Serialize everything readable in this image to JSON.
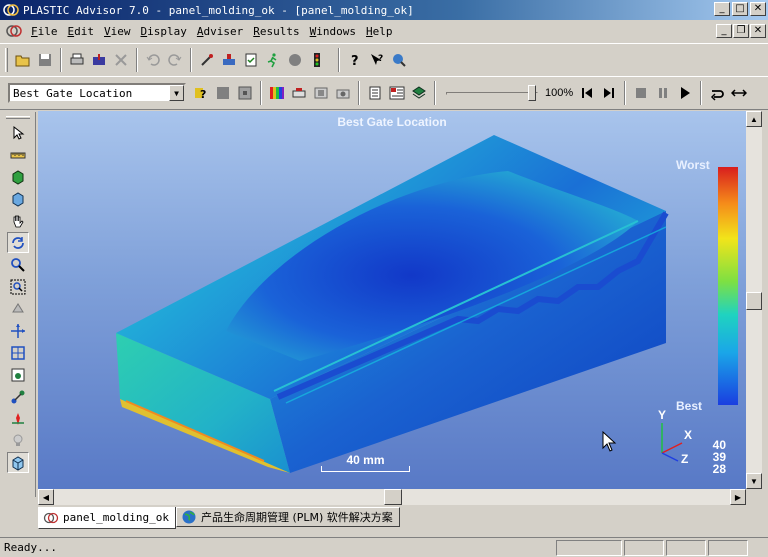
{
  "window": {
    "title": "PLASTIC Advisor 7.0 - panel_molding_ok - [panel_molding_ok]",
    "minimize_glyph": "_",
    "maximize_glyph": "□",
    "close_glyph": "✕",
    "restore_glyph": "❐"
  },
  "menubar": {
    "items": [
      {
        "key": "F",
        "rest": "ile"
      },
      {
        "key": "E",
        "rest": "dit"
      },
      {
        "key": "V",
        "rest": "iew"
      },
      {
        "key": "D",
        "rest": "isplay"
      },
      {
        "key": "A",
        "rest": "dviser"
      },
      {
        "key": "R",
        "rest": "esults"
      },
      {
        "key": "W",
        "rest": "indows"
      },
      {
        "key": "H",
        "rest": "elp"
      }
    ]
  },
  "toolbar2": {
    "result_select": "Best Gate Location",
    "zoom_value": "100%"
  },
  "viewport": {
    "title": "Best Gate Location",
    "legend_worst": "Worst",
    "legend_best": "Best",
    "scale_label": "40 mm",
    "axis_y": "Y",
    "axis_x": "X",
    "axis_z": "Z",
    "coords": [
      "40",
      "39",
      "28"
    ],
    "colorbar_colors": [
      "#d81e1e",
      "#f58a1a",
      "#f2e41a",
      "#7ee042",
      "#1fd3c0",
      "#1aa6e8",
      "#1a3ee0"
    ]
  },
  "tabs": [
    {
      "label": "panel_molding_ok",
      "active": true
    },
    {
      "label": "产品生命周期管理 (PLM) 软件解决方案",
      "active": false
    }
  ],
  "status": {
    "text": "Ready..."
  }
}
